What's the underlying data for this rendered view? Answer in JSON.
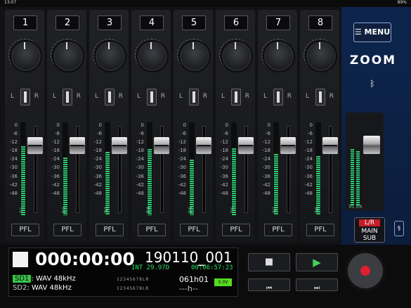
{
  "status_bar": {
    "time": "13:07",
    "battery": "89%"
  },
  "channels": [
    {
      "number": "1",
      "pan_left": "L",
      "pan_right": "R",
      "track_label": "Tr1",
      "pfl": "PFL"
    },
    {
      "number": "2",
      "pan_left": "L",
      "pan_right": "R",
      "track_label": "Tr2",
      "pfl": "PFL"
    },
    {
      "number": "3",
      "pan_left": "L",
      "pan_right": "R",
      "track_label": "Tr3",
      "pfl": "PFL"
    },
    {
      "number": "4",
      "pan_left": "L",
      "pan_right": "R",
      "track_label": "Tr4",
      "pfl": "PFL"
    },
    {
      "number": "5",
      "pan_left": "L",
      "pan_right": "R",
      "track_label": "Tr5",
      "pfl": "PFL"
    },
    {
      "number": "6",
      "pan_left": "L",
      "pan_right": "R",
      "track_label": "Tr6",
      "pfl": "PFL"
    },
    {
      "number": "7",
      "pan_left": "L",
      "pan_right": "R",
      "track_label": "Tr7",
      "pfl": "PFL"
    },
    {
      "number": "8",
      "pan_left": "L",
      "pan_right": "R",
      "track_label": "Tr8",
      "pfl": "PFL"
    }
  ],
  "meter_scale": [
    "0",
    "-6",
    "-12",
    "-18",
    "-24",
    "-30",
    "-36",
    "-42",
    "-48"
  ],
  "master": {
    "left_label": "TrL",
    "right_label": "TrR",
    "lr_button": "L/R",
    "main": "MAIN",
    "sub": "SUB"
  },
  "side": {
    "menu_label": "MENU",
    "logo_text": "ZOOM",
    "bluetooth_icon": "bluetooth-icon"
  },
  "recording": {
    "counter": "000:00:00",
    "filename": "190110_001",
    "frame_rate": "INT 29.97D",
    "timecode": "00:06:57:23",
    "sd1_tag": "SD1",
    "sd1_format": ": WAV 48kHz",
    "sd2_tag": "SD2",
    "sd2_format": ": WAV 48kHz",
    "track_map_1": "12345678LR",
    "track_map_2": "12345678LR",
    "take_1": "061h01",
    "take_2": "---h--",
    "battery": "5.0V"
  },
  "transport": {
    "stop_icon": "stop-icon",
    "play_icon": "play-icon",
    "rewind_icon": "rewind-icon",
    "fast_forward_icon": "fast-forward-icon",
    "record_icon": "record-icon"
  },
  "meter_levels": [
    0.74,
    0.62,
    0.68,
    0.71,
    0.6,
    0.72,
    0.66,
    0.64
  ],
  "master_levels": [
    0.58,
    0.56
  ],
  "colors": {
    "meter_green": "#2ecb72",
    "panel_blue": "#0d254d",
    "record_red": "#e01e32"
  }
}
